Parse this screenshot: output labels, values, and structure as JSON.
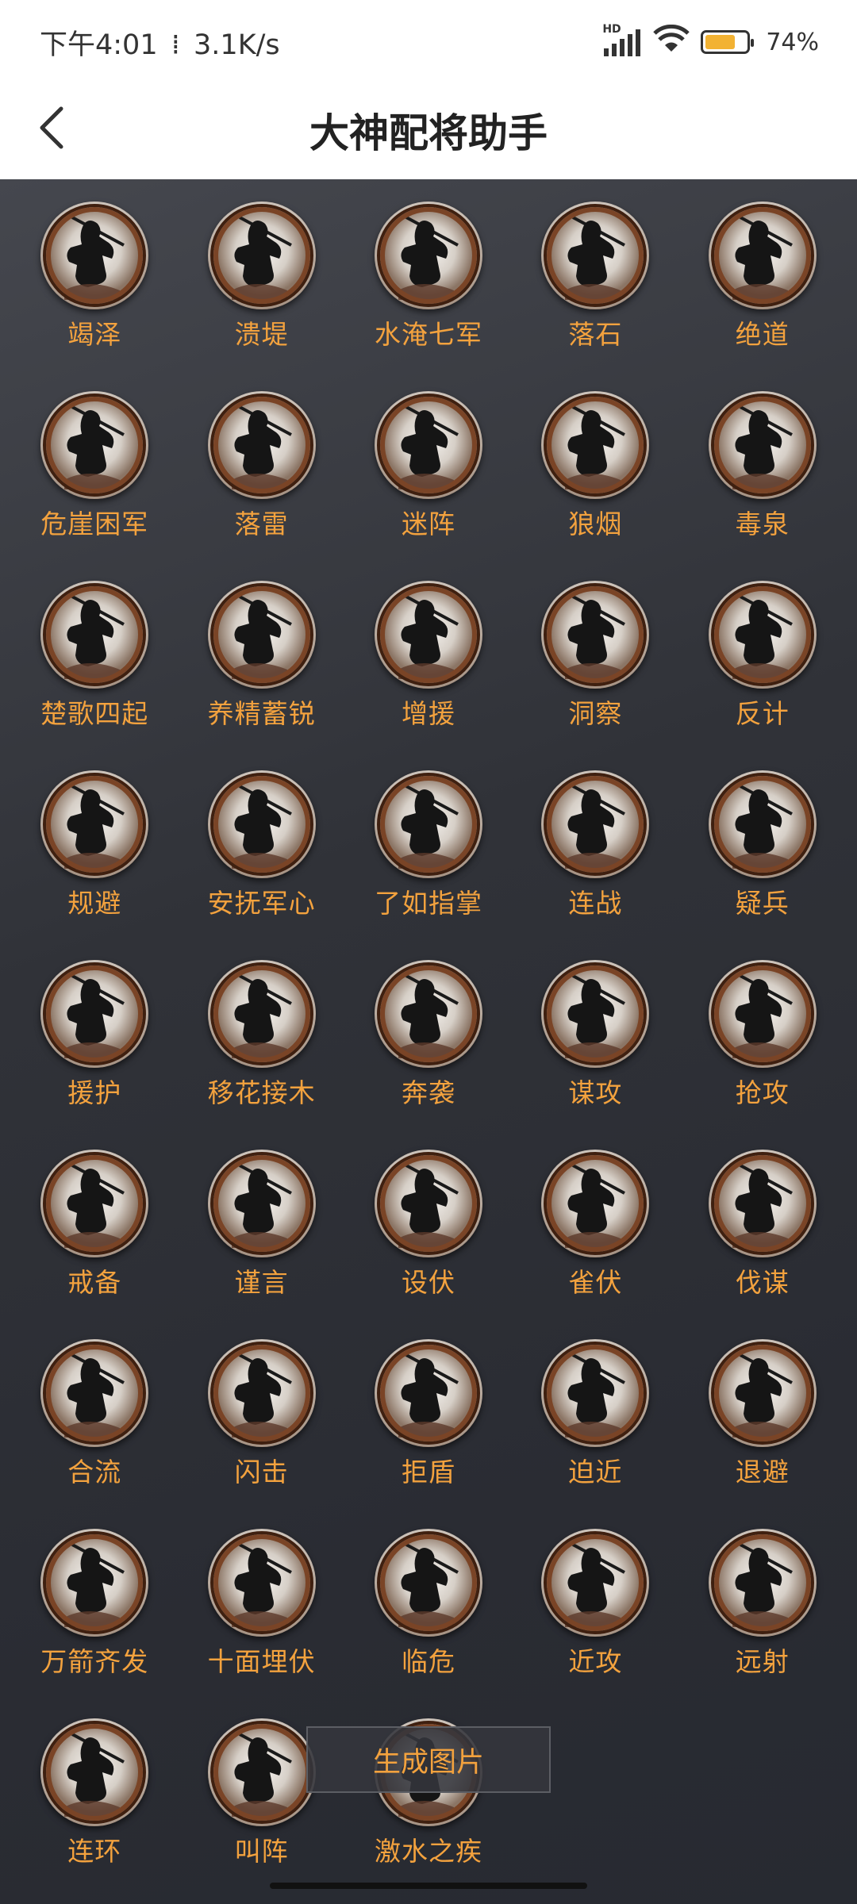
{
  "status_bar": {
    "time": "下午4:01",
    "speed": "3.1K/s",
    "hd_label": "HD",
    "battery_text": "74%",
    "battery_level": 0.74,
    "battery_color": "#f2b233"
  },
  "header": {
    "title": "大神配将助手",
    "back_icon": "chevron-left-icon"
  },
  "skills": [
    {
      "label": "竭泽"
    },
    {
      "label": "溃堤"
    },
    {
      "label": "水淹七军"
    },
    {
      "label": "落石"
    },
    {
      "label": "绝道"
    },
    {
      "label": "危崖困军"
    },
    {
      "label": "落雷"
    },
    {
      "label": "迷阵"
    },
    {
      "label": "狼烟"
    },
    {
      "label": "毒泉"
    },
    {
      "label": "楚歌四起"
    },
    {
      "label": "养精蓄锐"
    },
    {
      "label": "增援"
    },
    {
      "label": "洞察"
    },
    {
      "label": "反计"
    },
    {
      "label": "规避"
    },
    {
      "label": "安抚军心"
    },
    {
      "label": "了如指掌"
    },
    {
      "label": "连战"
    },
    {
      "label": "疑兵"
    },
    {
      "label": "援护"
    },
    {
      "label": "移花接木"
    },
    {
      "label": "奔袭"
    },
    {
      "label": "谋攻"
    },
    {
      "label": "抢攻"
    },
    {
      "label": "戒备"
    },
    {
      "label": "谨言"
    },
    {
      "label": "设伏"
    },
    {
      "label": "雀伏"
    },
    {
      "label": "伐谋"
    },
    {
      "label": "合流"
    },
    {
      "label": "闪击"
    },
    {
      "label": "拒盾"
    },
    {
      "label": "迫近"
    },
    {
      "label": "退避"
    },
    {
      "label": "万箭齐发"
    },
    {
      "label": "十面埋伏"
    },
    {
      "label": "临危"
    },
    {
      "label": "近攻"
    },
    {
      "label": "远射"
    },
    {
      "label": "连环"
    },
    {
      "label": "叫阵"
    },
    {
      "label": "激水之疾"
    }
  ],
  "skill_icon": "warrior-silhouette-icon",
  "generate_button": {
    "label": "生成图片"
  },
  "colors": {
    "label": "#f3a23e",
    "background": "#303238",
    "icon_ring": "#6b3c22"
  }
}
